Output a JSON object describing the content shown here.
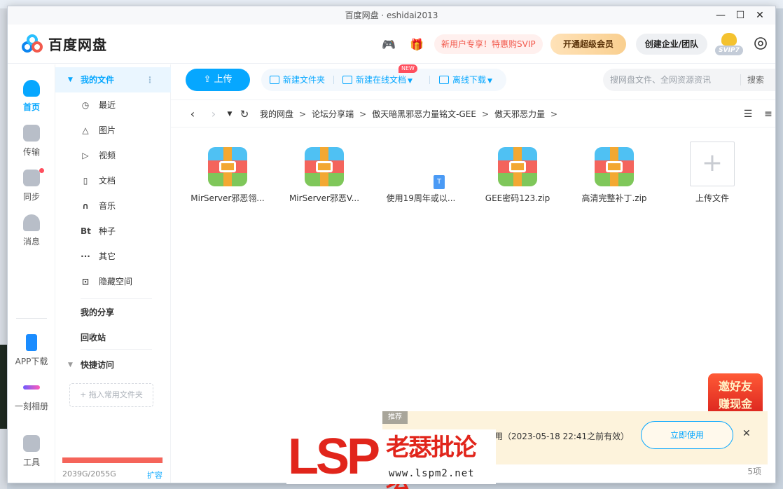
{
  "window": {
    "title": "百度网盘 · eshidai2013"
  },
  "window_controls": {
    "minimize": "—",
    "maximize": "☐",
    "close": "✕"
  },
  "header": {
    "logo_text": "百度网盘",
    "promo_text": "新用户专享！特惠购SVIP",
    "vip_button": "开通超级会员",
    "team_button": "创建企业/团队",
    "svip_badge": "SVIP7"
  },
  "rail": {
    "items": [
      {
        "label": "首页",
        "active": true
      },
      {
        "label": "传输"
      },
      {
        "label": "同步"
      },
      {
        "label": "消息"
      },
      {
        "label": "APP下载"
      },
      {
        "label": "一刻相册"
      },
      {
        "label": "工具"
      }
    ]
  },
  "sidebar": {
    "my_files": "我的文件",
    "categories": [
      {
        "icon": "clock-icon",
        "glyph": "◷",
        "label": "最近"
      },
      {
        "icon": "image-icon",
        "glyph": "△",
        "label": "图片"
      },
      {
        "icon": "video-icon",
        "glyph": "▷",
        "label": "视频"
      },
      {
        "icon": "doc-icon",
        "glyph": "▯",
        "label": "文档"
      },
      {
        "icon": "headphone-icon",
        "glyph": "∩",
        "label": "音乐"
      },
      {
        "icon": "bt-icon",
        "glyph": "Bt",
        "label": "种子"
      },
      {
        "icon": "more-icon",
        "glyph": "···",
        "label": "其它"
      },
      {
        "icon": "lock-icon",
        "glyph": "⊡",
        "label": "隐藏空间"
      }
    ],
    "my_share": "我的分享",
    "recycle": "回收站",
    "quick_access": "快捷访问",
    "drop_hint": "+ 拖入常用文件夹",
    "quota_text": "2039G/2055G",
    "quota_ratio": 0.992,
    "expand_link": "扩容"
  },
  "toolbar": {
    "upload": "上传",
    "new_folder": "新建文件夹",
    "new_online_doc": "新建在线文档",
    "new_badge": "NEW",
    "offline_download": "离线下载",
    "search_placeholder": "搜网盘文件、全网资源资讯",
    "search_button": "搜索"
  },
  "breadcrumb": {
    "items": [
      "我的网盘",
      "论坛分享端",
      "傲天暗黑邪恶力量铭文-GEE",
      "傲天邪恶力量"
    ],
    "sep": ">"
  },
  "files": [
    {
      "name": "MirServer邪恶翎...",
      "type": "zip"
    },
    {
      "name": "MirServer邪恶V...",
      "type": "zip"
    },
    {
      "name": "使用19周年或以...",
      "type": "txt"
    },
    {
      "name": "GEE密码123.zip",
      "type": "zip"
    },
    {
      "name": "高清完整补丁.zip",
      "type": "zip"
    },
    {
      "name": "上传文件",
      "type": "upload"
    }
  ],
  "file_count": "5项",
  "invite_promo": {
    "line1": "邀好友",
    "line2": "赚现金"
  },
  "notice": {
    "tag": "推荐",
    "message": "用（2023-05-18 22:41之前有效）",
    "button": "立即使用",
    "close": "✕"
  },
  "watermark": {
    "brand": "LSP",
    "cn_name": "老瑟批论坛",
    "url": "www.lspm2.net"
  },
  "colors": {
    "accent": "#06a7ff",
    "promo_red": "#f25a4d",
    "quota_red": "#f5645a"
  }
}
